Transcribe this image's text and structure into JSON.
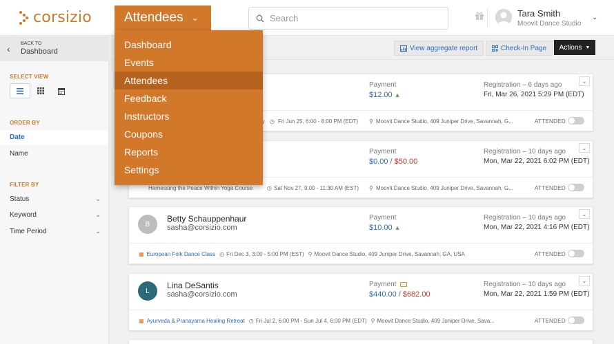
{
  "brand": {
    "name": "corsizio",
    "color": "#d2782b"
  },
  "nav": {
    "current": "Attendees"
  },
  "search": {
    "placeholder": "Search"
  },
  "user": {
    "name": "Tara Smith",
    "org": "Moovit Dance Studio"
  },
  "sidebar": {
    "back_small": "BACK TO",
    "back_label": "Dashboard",
    "select_view_label": "SELECT VIEW",
    "views": [
      "list-icon",
      "grid-icon",
      "calendar-icon"
    ],
    "order_by_label": "ORDER BY",
    "order_items": [
      "Date",
      "Name"
    ],
    "filter_by_label": "FILTER BY",
    "filters": [
      "Status",
      "Keyword",
      "Time Period"
    ]
  },
  "actions": {
    "aggregate": "View aggregate report",
    "checkin": "Check-In Page",
    "actions": "Actions"
  },
  "menu": {
    "items": [
      "Dashboard",
      "Events",
      "Attendees",
      "Feedback",
      "Instructors",
      "Coupons",
      "Reports",
      "Settings"
    ]
  },
  "cards": [
    {
      "initial": "",
      "name": "",
      "email": "",
      "payment_label": "Payment",
      "paid": "$12.00",
      "due": "",
      "reg_label": "Registration – 6 days ago",
      "reg_date": "Fri, Mar 26, 2021 5:29 PM (EDT)",
      "event": "dy",
      "datetime": "Fri Jun 25, 6:00 - 8:00 PM (EDT)",
      "location": "Moovit Dance Studio, 409 Juniper Drive, Savannah, G...",
      "attended": "ATTENDED"
    },
    {
      "initial": "",
      "name": "",
      "email": "",
      "payment_label": "Payment",
      "paid": "$0.00",
      "due": "$50.00",
      "reg_label": "Registration – 10 days ago",
      "reg_date": "Mon, Mar 22, 2021 6:02 PM (EDT)",
      "event": "Harnessing the Peace Within Yoga Course",
      "datetime": "Sat Nov 27, 9:00 - 11:30 AM (EST)",
      "location": "Moovit Dance Studio, 409 Juniper Drive, Savannah, G...",
      "attended": "ATTENDED"
    },
    {
      "initial": "B",
      "name": "Betty Schauppenhaur",
      "email": "sasha@corsizio.com",
      "payment_label": "Payment",
      "paid": "$10.00",
      "due": "",
      "reg_label": "Registration – 10 days ago",
      "reg_date": "Mon, Mar 22, 2021 4:16 PM (EDT)",
      "event": "European Folk Dance Class",
      "datetime": "Fri Dec 3, 3:00 - 5:00 PM (EST)",
      "location": "Moovit Dance Studio, 409 Juniper Drive, Savannah, GA, USA",
      "attended": "ATTENDED"
    },
    {
      "initial": "L",
      "name": "Lina DeSantis",
      "email": "sasha@corsizio.com",
      "payment_label": "Payment",
      "paid": "$440.00",
      "due": "$682.00",
      "reg_label": "Registration – 10 days ago",
      "reg_date": "Mon, Mar 22, 2021 1:59 PM (EDT)",
      "event": "Ayurveda & Pranayama Healing Retreat",
      "datetime": "Fri Jul 2, 6:00 PM - Sun Jul 4, 6:00 PM (EDT)",
      "location": "Moovit Dance Studio, 409 Juniper Drive, Sava...",
      "attended": "ATTENDED"
    }
  ]
}
